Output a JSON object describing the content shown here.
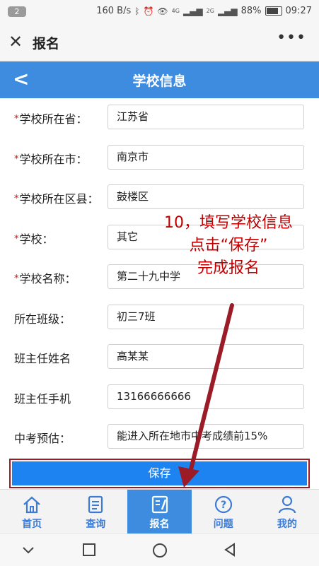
{
  "status_bar": {
    "notification_count": "2",
    "net_speed": "160 B/s",
    "net_type_1": "4G",
    "net_type_2": "2G",
    "battery": "88%",
    "time": "09:27"
  },
  "app_bar": {
    "title": "报名"
  },
  "header": {
    "title": "学校信息"
  },
  "form": {
    "rows": [
      {
        "label": "学校所在省：",
        "required": true,
        "value": "江苏省"
      },
      {
        "label": "学校所在市：",
        "required": true,
        "value": "南京市"
      },
      {
        "label": "学校所在区县：",
        "required": true,
        "value": "鼓楼区"
      },
      {
        "label": "学校：",
        "required": true,
        "value": "其它"
      },
      {
        "label": "学校名称：",
        "required": true,
        "value": "第二十九中学"
      },
      {
        "label": "所在班级：",
        "required": false,
        "value": "初三7班"
      },
      {
        "label": "班主任姓名",
        "required": false,
        "value": "高某某"
      },
      {
        "label": "班主任手机",
        "required": false,
        "value": "13166666666"
      },
      {
        "label": "中考预估：",
        "required": false,
        "value": "能进入所在地市中考成绩前15%"
      }
    ],
    "save_label": "保存"
  },
  "annotation": {
    "lines": [
      "10，填写学校信息",
      "点击“保存”",
      "完成报名"
    ],
    "color": "#c00000"
  },
  "tabs": [
    {
      "label": "首页",
      "icon": "home-icon",
      "active": false
    },
    {
      "label": "查询",
      "icon": "document-icon",
      "active": false
    },
    {
      "label": "报名",
      "icon": "signup-icon",
      "active": true
    },
    {
      "label": "问题",
      "icon": "question-icon",
      "active": false
    },
    {
      "label": "我的",
      "icon": "user-icon",
      "active": false
    }
  ],
  "colors": {
    "accent": "#3d8ce0",
    "save_button": "#1d83f0",
    "required": "#d01010"
  }
}
